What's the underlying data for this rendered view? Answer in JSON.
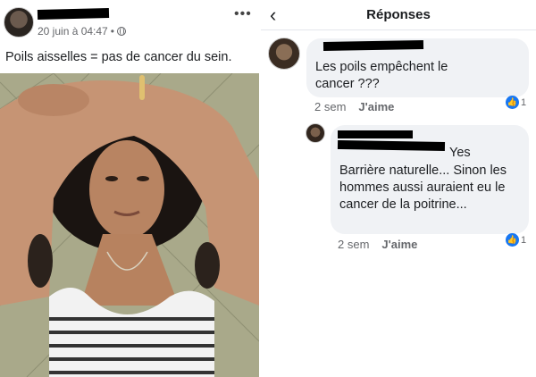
{
  "post": {
    "timestamp": "20 juin à 04:47",
    "dot": "•",
    "more_label": "•••",
    "text": "Poils aisselles = pas de cancer du sein."
  },
  "replies": {
    "title": "Réponses",
    "back_label": "‹",
    "comments": [
      {
        "text": "Les poils empêchent le cancer ???",
        "time": "2 sem",
        "like_label": "J'aime",
        "reaction_count": "1"
      },
      {
        "text_prefix": "Yes",
        "text": "Barrière naturelle... Sinon les hommes aussi auraient eu le cancer de la poitrine...",
        "time": "2 sem",
        "like_label": "J'aime",
        "reaction_count": "1"
      }
    ]
  },
  "colors": {
    "link_blue": "#1877f2",
    "bubble_bg": "#f0f2f5",
    "meta_gray": "#65676b"
  }
}
